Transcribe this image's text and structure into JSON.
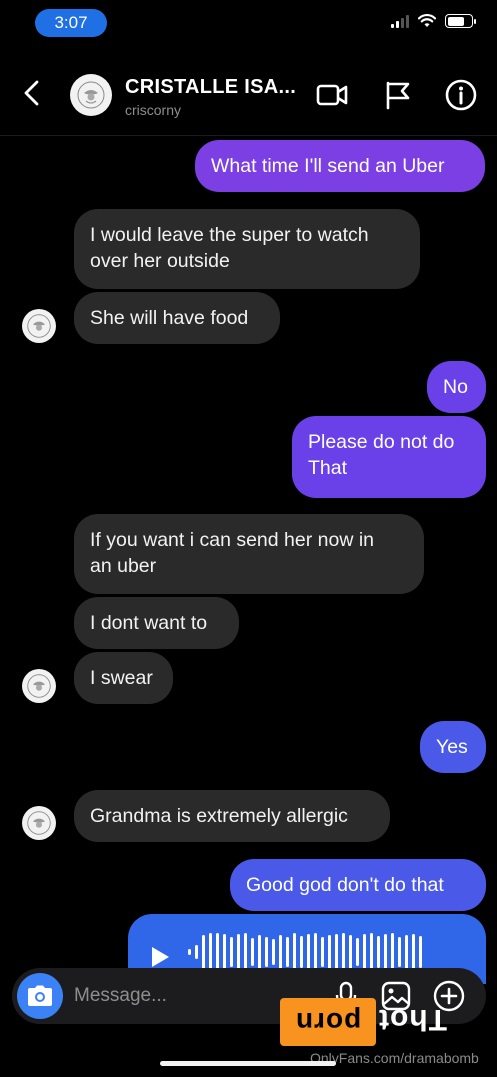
{
  "status_bar": {
    "time": "3:07"
  },
  "header": {
    "contact_name": "CRISTALLE ISA...",
    "contact_handle": "criscorny",
    "icons": [
      "back-chevron-icon",
      "video-call-icon",
      "flag-icon",
      "info-icon"
    ]
  },
  "messages": [
    {
      "dir": "out",
      "text": "What time I'll send an Uber"
    },
    {
      "dir": "in",
      "text": "I would leave the super to watch\nover her outside"
    },
    {
      "dir": "in",
      "text": "She will have food"
    },
    {
      "dir": "out",
      "text": "No"
    },
    {
      "dir": "out",
      "text": "Please do not do\nThat"
    },
    {
      "dir": "in",
      "text": "If you want i can send her now in\nan uber"
    },
    {
      "dir": "in",
      "text": "I dont want to"
    },
    {
      "dir": "in",
      "text": "I swear"
    },
    {
      "dir": "out",
      "text": "Yes"
    },
    {
      "dir": "in",
      "text": "Grandma is extremely allergic"
    },
    {
      "dir": "out",
      "text": "Good god don't do that"
    },
    {
      "dir": "out",
      "type": "voice",
      "icon": "play-icon"
    }
  ],
  "composer": {
    "placeholder": "Message...",
    "icons": [
      "camera-icon",
      "microphone-icon",
      "gallery-icon",
      "add-icon"
    ]
  },
  "watermark": {
    "badge_box": "porn",
    "badge_text": "Thot",
    "text": "OnlyFans.com/dramabomb"
  }
}
